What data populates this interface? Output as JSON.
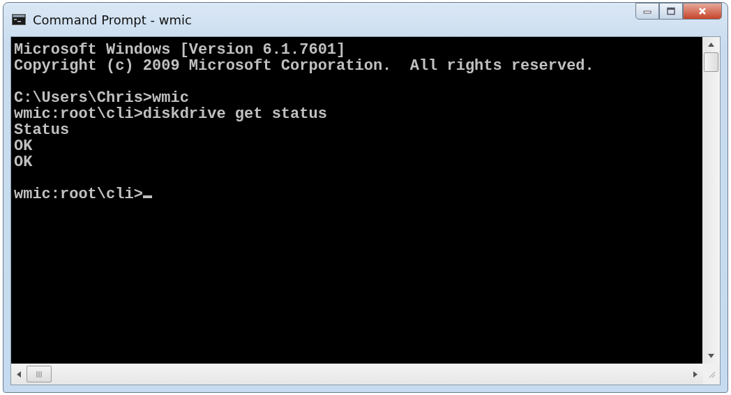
{
  "window": {
    "title": "Command Prompt - wmic"
  },
  "console": {
    "blocks": [
      [
        "Microsoft Windows [Version 6.1.7601]",
        "Copyright (c) 2009 Microsoft Corporation.  All rights reserved."
      ],
      [
        "C:\\Users\\Chris>wmic",
        "wmic:root\\cli>diskdrive get status",
        "Status",
        "OK",
        "OK"
      ],
      [
        "wmic:root\\cli>"
      ]
    ],
    "cursor": true
  }
}
